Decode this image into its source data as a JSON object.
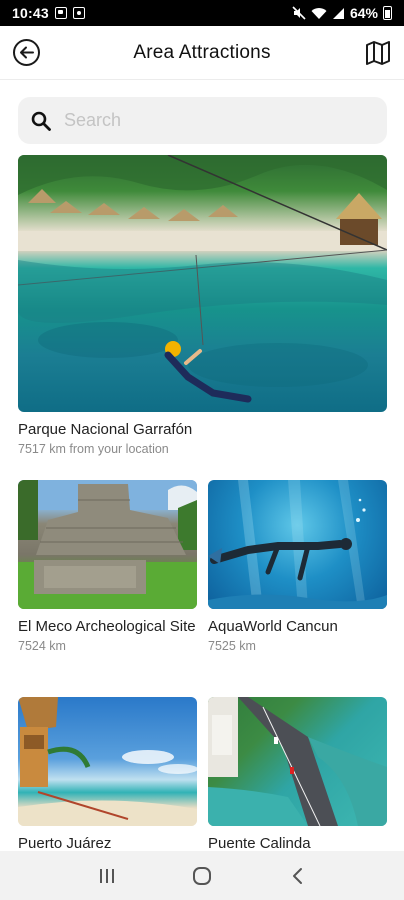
{
  "status_bar": {
    "time": "10:43",
    "battery": "64%"
  },
  "header": {
    "title": "Area Attractions",
    "back_icon": "back-arrow-circle-icon",
    "map_icon": "map-icon"
  },
  "search": {
    "placeholder": "Search",
    "value": ""
  },
  "attractions": [
    {
      "name": "Parque Nacional Garrafón",
      "distance": "7517 km from your location"
    },
    {
      "name": "El Meco Archeological Site",
      "distance": "7524 km"
    },
    {
      "name": "AquaWorld Cancun",
      "distance": "7525 km"
    },
    {
      "name": "Puerto Juárez",
      "distance": ""
    },
    {
      "name": "Puente Calinda",
      "distance": ""
    }
  ],
  "colors": {
    "background": "#ffffff",
    "search_bg": "#f1f1f1",
    "text_primary": "#222222",
    "text_secondary": "#8a8a8a",
    "nav_bg": "#f2f2f2"
  }
}
